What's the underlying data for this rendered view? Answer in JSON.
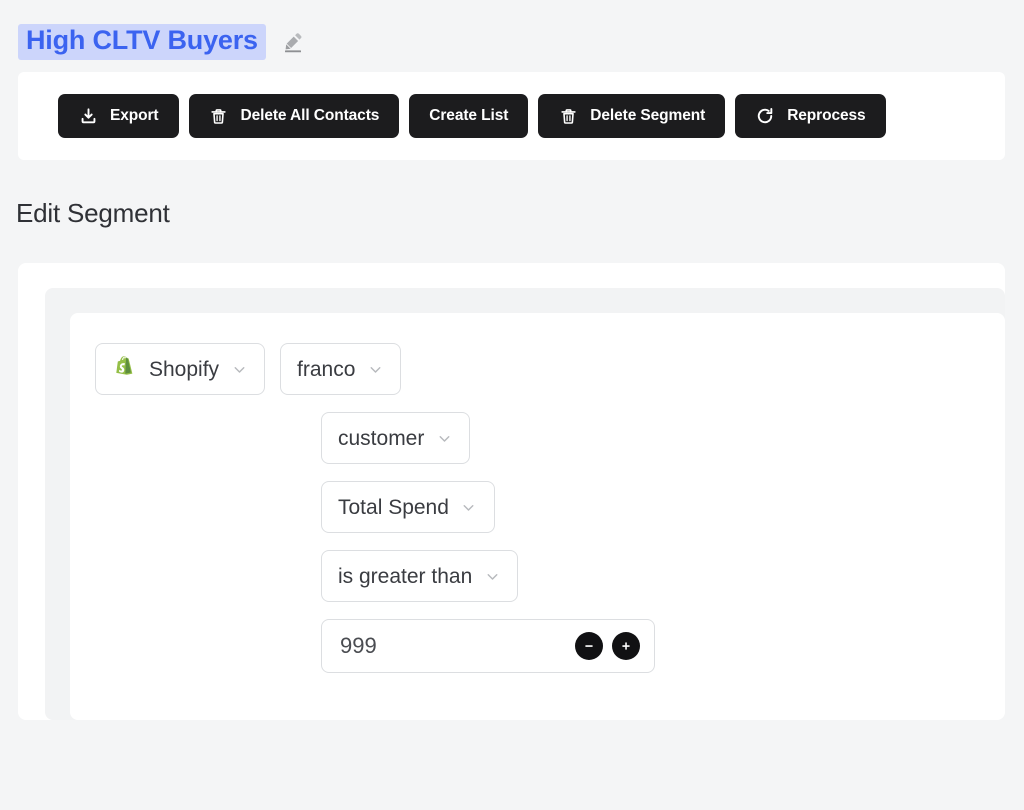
{
  "page": {
    "background": "#f4f5f6"
  },
  "header": {
    "segment_name": "High CLTV Buyers",
    "segment_name_color": "#3b63f0",
    "segment_name_highlight": "#ccd5fb",
    "edit_icon": "pencil-edit-icon"
  },
  "toolbar": {
    "buttons": [
      {
        "label": "Export",
        "icon": "download-icon"
      },
      {
        "label": "Delete All Contacts",
        "icon": "trash-icon"
      },
      {
        "label": "Create List",
        "icon": ""
      },
      {
        "label": "Delete Segment",
        "icon": "trash-icon"
      },
      {
        "label": "Reprocess",
        "icon": "refresh-icon"
      }
    ],
    "button_bg": "#1c1c1e",
    "button_text_color": "#ffffff"
  },
  "section": {
    "heading": "Edit Segment"
  },
  "builder": {
    "rows": [
      {
        "id": "source-row",
        "pills": [
          {
            "name": "source-select",
            "label": "Shopify",
            "icon": "shopify-logo-icon",
            "chevron": true
          },
          {
            "name": "account-select",
            "label": "franco",
            "icon": "",
            "chevron": true
          }
        ]
      },
      {
        "id": "object-row",
        "pills": [
          {
            "name": "object-select",
            "label": "customer",
            "icon": "",
            "chevron": true
          }
        ]
      },
      {
        "id": "field-row",
        "pills": [
          {
            "name": "field-select",
            "label": "Total Spend",
            "icon": "",
            "chevron": true
          }
        ]
      },
      {
        "id": "operator-row",
        "pills": [
          {
            "name": "operator-select",
            "label": "is greater than",
            "icon": "",
            "chevron": true
          }
        ]
      }
    ],
    "value_field": {
      "name": "threshold-value-input",
      "value": "999",
      "placeholder": "",
      "decrement_label": "−",
      "increment_label": "+"
    }
  }
}
